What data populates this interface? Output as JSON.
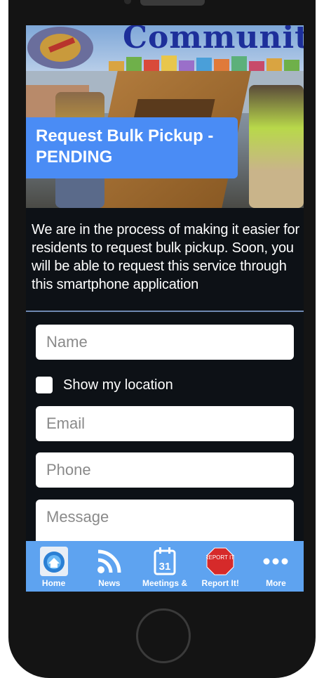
{
  "banner": {
    "title": "Community"
  },
  "hero": {
    "title_line1": "Request Bulk Pickup -",
    "title_line2": "PENDING"
  },
  "description": "We are in the process of making it easier for residents to request bulk pickup. Soon, you will be able to request this service through this smartphone application",
  "form": {
    "name_placeholder": "Name",
    "show_location_label": "Show my location",
    "email_placeholder": "Email",
    "phone_placeholder": "Phone",
    "message_placeholder": "Message"
  },
  "tabs": [
    {
      "label": "Home",
      "icon": "home-icon"
    },
    {
      "label": "News",
      "icon": "rss-icon"
    },
    {
      "label": "Meetings &",
      "icon": "calendar-icon",
      "icon_text": "31"
    },
    {
      "label": "Report It!",
      "icon": "report-icon",
      "icon_text": "REPORT IT!"
    },
    {
      "label": "More",
      "icon": "more-icon"
    }
  ],
  "colors": {
    "title_box": "#4a8cf5",
    "tab_bar": "#5ea3f0",
    "screen_bg": "#0d1116"
  }
}
